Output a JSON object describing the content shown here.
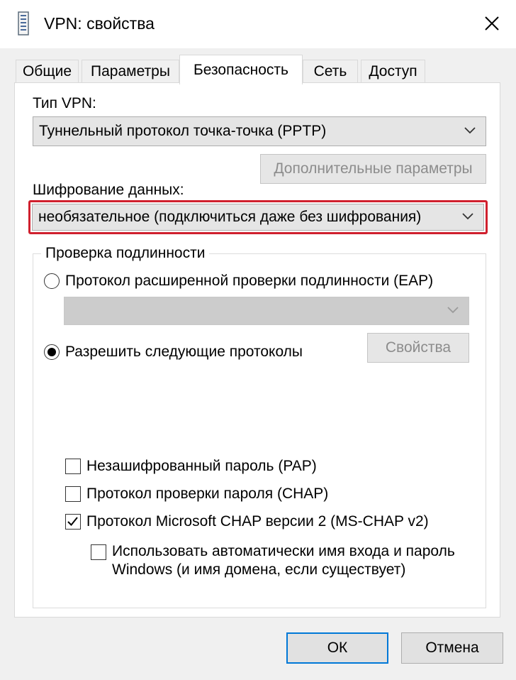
{
  "window": {
    "title": "VPN: свойства",
    "icon": "network-connection-icon",
    "close_icon": "close-icon"
  },
  "tabs": [
    {
      "label": "Общие",
      "active": false
    },
    {
      "label": "Параметры",
      "active": false
    },
    {
      "label": "Безопасность",
      "active": true
    },
    {
      "label": "Сеть",
      "active": false
    },
    {
      "label": "Доступ",
      "active": false
    }
  ],
  "vpn_type": {
    "label": "Тип VPN:",
    "value": "Туннельный протокол точка-точка (PPTP)"
  },
  "advanced_button": {
    "label": "Дополнительные параметры",
    "enabled": false
  },
  "encryption": {
    "label": "Шифрование данных:",
    "value": "необязательное (подключиться даже без шифрования)",
    "highlight_color": "#d0202e"
  },
  "auth": {
    "title": "Проверка подлинности",
    "eap": {
      "label": "Протокол расширенной проверки подлинности (EAP)",
      "selected": false,
      "dropdown_value": ""
    },
    "allow": {
      "label": "Разрешить следующие протоколы",
      "selected": true
    },
    "properties_button": {
      "label": "Свойства",
      "enabled": false
    },
    "protocols": [
      {
        "label": "Незашифрованный пароль (PAP)",
        "checked": false
      },
      {
        "label": "Протокол проверки пароля (CHAP)",
        "checked": false
      },
      {
        "label": "Протокол Microsoft CHAP версии 2 (MS-CHAP v2)",
        "checked": true
      }
    ],
    "auto_login": {
      "line1": "Использовать автоматически имя входа и пароль",
      "line2": "Windows (и имя домена, если существует)",
      "checked": false
    }
  },
  "buttons": {
    "ok": "ОК",
    "cancel": "Отмена"
  },
  "colors": {
    "accent": "#0078d7",
    "dialog_bg": "#f0f0f0"
  }
}
